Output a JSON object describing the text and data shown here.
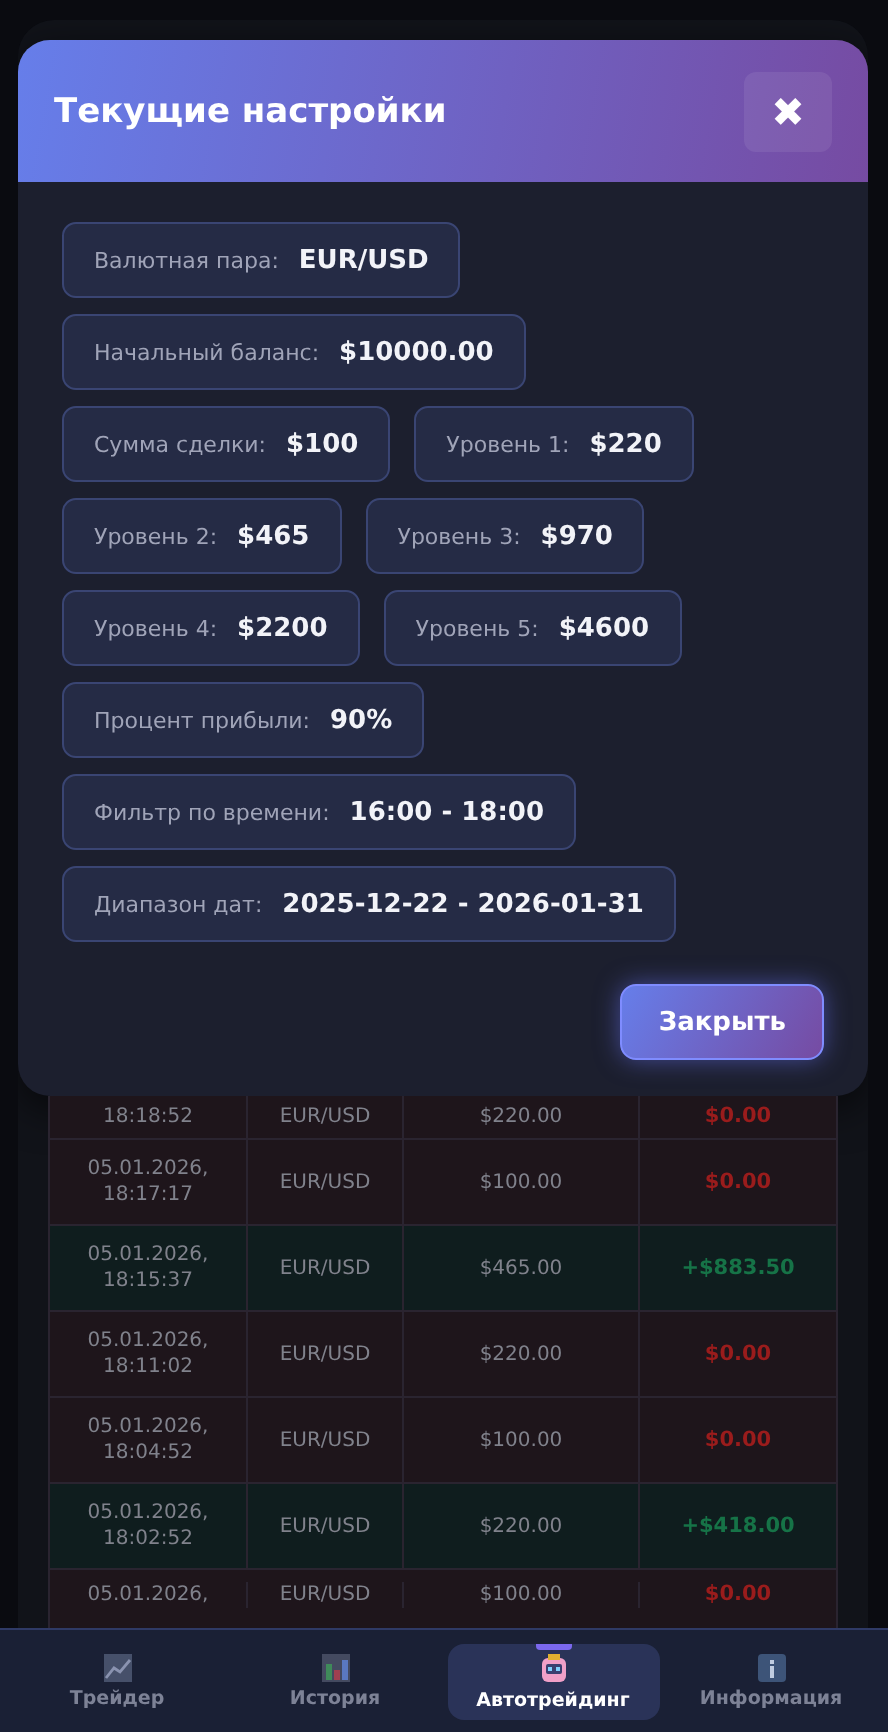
{
  "modal": {
    "title": "Текущие настройки",
    "close_icon": "✖",
    "setting_rows": [
      {
        "items": [
          {
            "label": "Валютная пара:",
            "value": "EUR/USD"
          }
        ]
      },
      {
        "items": [
          {
            "label": "Начальный баланс:",
            "value": "$10000.00"
          }
        ]
      },
      {
        "items": [
          {
            "label": "Сумма сделки:",
            "value": "$100"
          },
          {
            "label": "Уровень 1:",
            "value": "$220"
          }
        ]
      },
      {
        "items": [
          {
            "label": "Уровень 2:",
            "value": "$465"
          },
          {
            "label": "Уровень 3:",
            "value": "$970"
          }
        ]
      },
      {
        "items": [
          {
            "label": "Уровень 4:",
            "value": "$2200"
          },
          {
            "label": "Уровень 5:",
            "value": "$4600"
          }
        ]
      },
      {
        "items": [
          {
            "label": "Процент прибыли:",
            "value": "90%"
          }
        ]
      },
      {
        "items": [
          {
            "label": "Фильтр по времени:",
            "value": "16:00 - 18:00"
          }
        ]
      },
      {
        "items": [
          {
            "label": "Диапазон дат:",
            "value": "2025-12-22 - 2026-01-31"
          }
        ]
      }
    ],
    "button": "Закрыть"
  },
  "table": {
    "rows": [
      {
        "kind": "loss",
        "time": "18:18:52",
        "pair": "EUR/USD",
        "amount": "$220.00",
        "result": "$0.00"
      },
      {
        "kind": "loss",
        "time": "05.01.2026, 18:17:17",
        "pair": "EUR/USD",
        "amount": "$100.00",
        "result": "$0.00"
      },
      {
        "kind": "win",
        "time": "05.01.2026, 18:15:37",
        "pair": "EUR/USD",
        "amount": "$465.00",
        "result": "+$883.50"
      },
      {
        "kind": "loss",
        "time": "05.01.2026, 18:11:02",
        "pair": "EUR/USD",
        "amount": "$220.00",
        "result": "$0.00"
      },
      {
        "kind": "loss",
        "time": "05.01.2026, 18:04:52",
        "pair": "EUR/USD",
        "amount": "$100.00",
        "result": "$0.00"
      },
      {
        "kind": "win",
        "time": "05.01.2026, 18:02:52",
        "pair": "EUR/USD",
        "amount": "$220.00",
        "result": "+$418.00"
      },
      {
        "kind": "loss",
        "time": "05.01.2026,",
        "pair": "EUR/USD",
        "amount": "$100.00",
        "result": "$0.00"
      }
    ]
  },
  "nav": [
    {
      "label": "Трейдер",
      "selected": false
    },
    {
      "label": "История",
      "selected": false
    },
    {
      "label": "Автотрейдинг",
      "selected": true
    },
    {
      "label": "Информация",
      "selected": false
    }
  ]
}
